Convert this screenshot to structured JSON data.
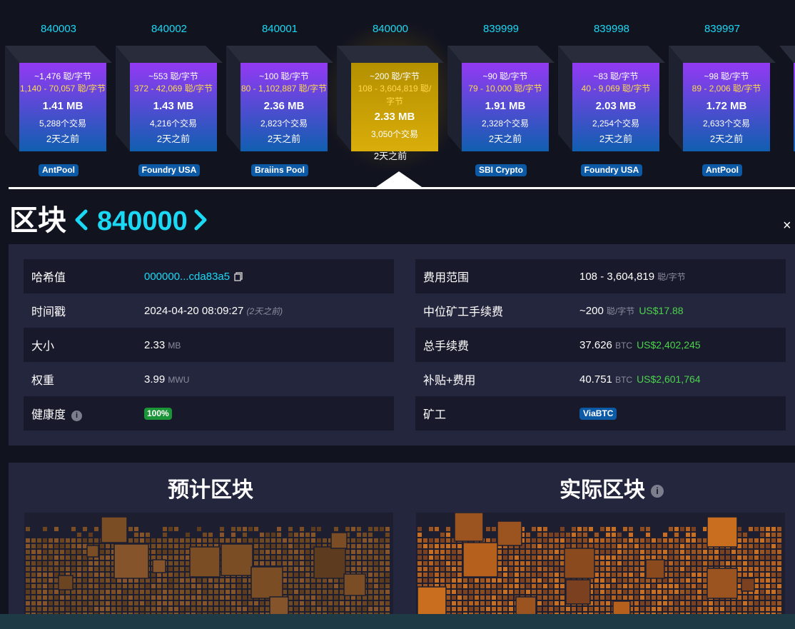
{
  "blocks": [
    {
      "height": "840003",
      "median_fee": "~1,476 聪/字节",
      "fee_range": "1,140 - 70,057 聪/字节",
      "size": "1.41 MB",
      "tx_count": "5,288个交易",
      "age": "2天之前",
      "pool": "AntPool",
      "selected": false
    },
    {
      "height": "840002",
      "median_fee": "~553 聪/字节",
      "fee_range": "372 - 42,069 聪/字节",
      "size": "1.43 MB",
      "tx_count": "4,216个交易",
      "age": "2天之前",
      "pool": "Foundry USA",
      "selected": false
    },
    {
      "height": "840001",
      "median_fee": "~100 聪/字节",
      "fee_range": "80 - 1,102,887 聪/字节",
      "size": "2.36 MB",
      "tx_count": "2,823个交易",
      "age": "2天之前",
      "pool": "Braiins Pool",
      "selected": false
    },
    {
      "height": "840000",
      "median_fee": "~200 聪/字节",
      "fee_range": "108 - 3,604,819 聪/字节",
      "size": "2.33 MB",
      "tx_count": "3,050个交易",
      "age": "2天之前",
      "pool": "",
      "selected": true
    },
    {
      "height": "839999",
      "median_fee": "~90 聪/字节",
      "fee_range": "79 - 10,000 聪/字节",
      "size": "1.91 MB",
      "tx_count": "2,328个交易",
      "age": "2天之前",
      "pool": "SBI Crypto",
      "selected": false
    },
    {
      "height": "839998",
      "median_fee": "~83 聪/字节",
      "fee_range": "40 - 9,069 聪/字节",
      "size": "2.03 MB",
      "tx_count": "2,254个交易",
      "age": "2天之前",
      "pool": "Foundry USA",
      "selected": false
    },
    {
      "height": "839997",
      "median_fee": "~98 聪/字节",
      "fee_range": "89 - 2,006 聪/字节",
      "size": "1.72 MB",
      "tx_count": "2,633个交易",
      "age": "2天之前",
      "pool": "AntPool",
      "selected": false
    }
  ],
  "header": {
    "title": "区块",
    "block_number": "840000",
    "prev_icon": "chevron-left-icon",
    "next_icon": "chevron-right-icon",
    "close_glyph": "×"
  },
  "details": {
    "left": [
      {
        "label": "哈希值",
        "value": "000000...cda83a5",
        "type": "hash"
      },
      {
        "label": "时间戳",
        "value": "2024-04-20 08:09:27",
        "note": "(2天之前)",
        "type": "time"
      },
      {
        "label": "大小",
        "value": "2.33",
        "unit": "MB",
        "type": "unit"
      },
      {
        "label": "权重",
        "value": "3.99",
        "unit": "MWU",
        "type": "unit"
      },
      {
        "label": "健康度",
        "value": "100%",
        "type": "health"
      }
    ],
    "right": [
      {
        "label": "费用范围",
        "value": "108 - 3,604,819",
        "unit": "聪/字节",
        "type": "unit"
      },
      {
        "label": "中位矿工手续费",
        "value": "~200",
        "unit": "聪/字节",
        "usd": "US$17.88",
        "type": "usd"
      },
      {
        "label": "总手续费",
        "value": "37.626",
        "unit": "BTC",
        "usd": "US$2,402,245",
        "type": "usd"
      },
      {
        "label": "补贴+费用",
        "value": "40.751",
        "unit": "BTC",
        "usd": "US$2,601,764",
        "type": "usd"
      },
      {
        "label": "矿工",
        "value": "ViaBTC",
        "type": "miner"
      }
    ]
  },
  "compare": {
    "projected_title": "预计区块",
    "actual_title": "实际区块",
    "info_glyph": "i"
  },
  "colors": {
    "accent_cyan": "#1bd8f4",
    "fee_yellow": "#ffd84d",
    "usd_green": "#4bd34b",
    "pool_blue": "#0c59a6",
    "health_green": "#1a9436"
  }
}
